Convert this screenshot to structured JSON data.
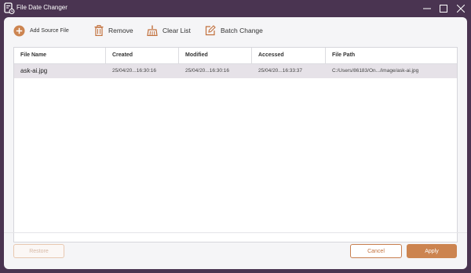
{
  "window": {
    "title": "File Date Changer"
  },
  "toolbar": {
    "add_label": "Add Source File",
    "remove_label": "Remove",
    "clear_label": "Clear List",
    "batch_label": "Batch Change"
  },
  "table": {
    "columns": [
      "File Name",
      "Created",
      "Modified",
      "Accessed",
      "File Path"
    ],
    "rows": [
      {
        "name": "ask-ai.jpg",
        "created": "25/04/20...16:30:16",
        "modified": "25/04/20...16:30:16",
        "accessed": "25/04/20...16:33:37",
        "path": "C:/Users/86183/On.../image/ask-ai.jpg"
      }
    ]
  },
  "footer": {
    "restore_label": "Restore",
    "cancel_label": "Cancel",
    "apply_label": "Apply"
  },
  "colors": {
    "accent": "#cc8450",
    "frame": "#4a3451"
  }
}
